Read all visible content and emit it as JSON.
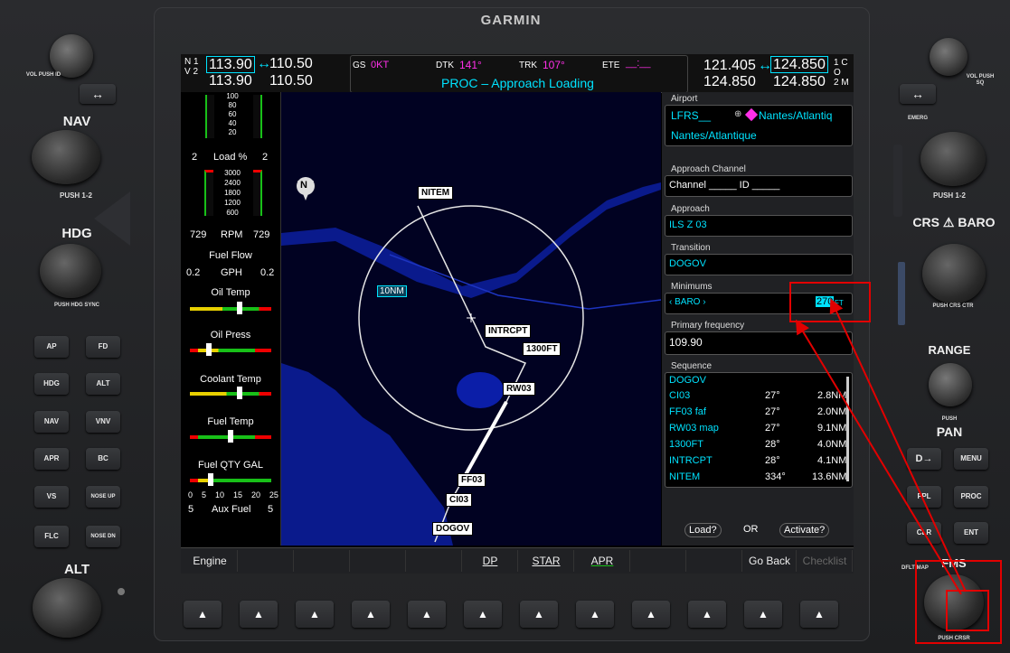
{
  "brand": "GARMIN",
  "left_bezel": {
    "vol_label": "VOL PUSH ID",
    "swap_arrow": "↔",
    "nav_label": "NAV",
    "push12": "PUSH 1-2",
    "hdg_label": "HDG",
    "push_hdg_sync": "PUSH HDG SYNC",
    "alt_label": "ALT",
    "ap_buttons": [
      [
        "AP",
        "FD"
      ],
      [
        "HDG",
        "ALT"
      ],
      [
        "NAV",
        "VNV"
      ],
      [
        "APR",
        "BC"
      ],
      [
        "VS",
        "NOSE UP"
      ],
      [
        "FLC",
        "NOSE DN"
      ]
    ]
  },
  "right_bezel": {
    "vol_label": "VOL PUSH SQ",
    "emerg": "EMERG",
    "push12": "PUSH 1-2",
    "crs_baro": "CRS",
    "baro": "BARO",
    "push_crs_ctr": "PUSH CRS CTR",
    "range": "RANGE",
    "push": "PUSH",
    "pan": "PAN",
    "direct": "D→",
    "menu": "MENU",
    "fpl": "FPL",
    "proc": "PROC",
    "clr": "CLR",
    "ent": "ENT",
    "fms": "FMS",
    "dflt_map": "DFLT MAP",
    "push_crsr": "PUSH CRSR"
  },
  "top": {
    "nav1_label": "N 1",
    "nav2_label": "V 2",
    "nav1_active": "113.90",
    "nav1_standby": "110.50",
    "nav2_active": "113.90",
    "nav2_standby": "110.50",
    "gs_label": "GS",
    "gs_val": "0KT",
    "dtk_label": "DTK",
    "dtk_val": "141°",
    "trk_label": "TRK",
    "trk_val": "107°",
    "ete_label": "ETE",
    "ete_val": "__:__",
    "status": "PROC – Approach Loading",
    "com1_active": "121.405",
    "com1_standby": "124.850",
    "com2_active": "124.850",
    "com2_standby": "124.850",
    "com1_label": "1 C",
    "com2_label": "2 M",
    "com_mid": "O"
  },
  "engine": {
    "load_scale": [
      "100",
      "80",
      "60",
      "40",
      "20"
    ],
    "load_left": "2",
    "load_label": "Load %",
    "load_right": "2",
    "rpm_scale": [
      "3000",
      "2400",
      "1800",
      "1200",
      "600"
    ],
    "rpm_left": "729",
    "rpm_label": "RPM",
    "rpm_right": "729",
    "fuel_flow": "Fuel Flow",
    "ff_left": "0.2",
    "ff_unit": "GPH",
    "ff_right": "0.2",
    "oil_temp": "Oil Temp",
    "oil_press": "Oil Press",
    "coolant_temp": "Coolant Temp",
    "fuel_temp": "Fuel Temp",
    "fuel_qty": "Fuel QTY GAL",
    "fuel_scale": [
      "0",
      "5",
      "10",
      "15",
      "20",
      "25"
    ],
    "aux_left": "5",
    "aux_label": "Aux Fuel",
    "aux_right": "5"
  },
  "map": {
    "north": "N",
    "range_ring": "10NM",
    "waypoints": {
      "nitem": "NITEM",
      "intrcpt": "INTRCPT",
      "ft1300": "1300FT",
      "rw03": "RW03",
      "ff03": "FF03",
      "ci03": "CI03",
      "dogov": "DOGOV"
    }
  },
  "panel": {
    "airport_title": "Airport",
    "airport_code": "LFRS__",
    "airport_city": "Nantes/Atlantiq",
    "airport_name": "Nantes/Atlantique",
    "approach_channel_title": "Approach Channel",
    "channel_text": "Channel _____ ID _____",
    "approach_title": "Approach",
    "approach": "ILS Z 03",
    "transition_title": "Transition",
    "transition": "DOGOV",
    "minimums_title": "Minimums",
    "minimums_type": "‹ BARO ›",
    "minimums_value": "270",
    "minimums_unit": "FT",
    "primary_freq_title": "Primary frequency",
    "primary_freq": "109.90",
    "sequence_title": "Sequence",
    "sequence": [
      {
        "wpt": "DOGOV",
        "crs": "",
        "dist": ""
      },
      {
        "wpt": "CI03",
        "crs": "27°",
        "dist": "2.8NM"
      },
      {
        "wpt": "FF03 faf",
        "crs": "27°",
        "dist": "2.0NM"
      },
      {
        "wpt": "RW03 map",
        "crs": "27°",
        "dist": "9.1NM"
      },
      {
        "wpt": "1300FT",
        "crs": "28°",
        "dist": "4.0NM"
      },
      {
        "wpt": "INTRCPT",
        "crs": "28°",
        "dist": "4.1NM"
      },
      {
        "wpt": "NITEM",
        "crs": "334°",
        "dist": "13.6NM"
      }
    ],
    "load_btn": "Load?",
    "or_text": "OR",
    "activate_btn": "Activate?"
  },
  "softkeys": [
    "Engine",
    "",
    "",
    "",
    "",
    "DP",
    "STAR",
    "APR",
    "",
    "",
    "Go Back",
    "Checklist"
  ],
  "bottom_key_glyph": "▲"
}
